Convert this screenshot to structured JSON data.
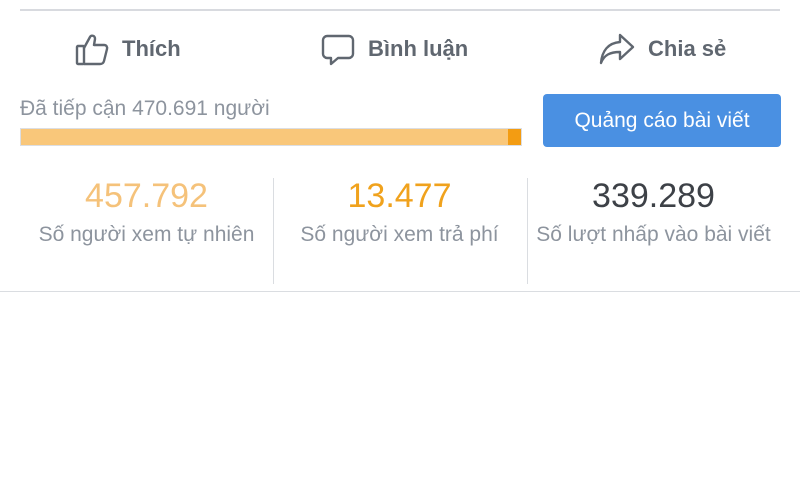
{
  "actions": {
    "like_label": "Thích",
    "comment_label": "Bình luận",
    "share_label": "Chia sẻ"
  },
  "reach": {
    "text": "Đã tiếp cận 470.691 người",
    "organic_fraction": 0.973,
    "paid_fraction": 0.027
  },
  "boost_button": {
    "label": "Quảng cáo bài viết"
  },
  "stats": [
    {
      "value": "457.792",
      "caption": "Số người xem tự nhiên"
    },
    {
      "value": "13.477",
      "caption": "Số người xem trả phí"
    },
    {
      "value": "339.289",
      "caption": "Số lượt nhấp vào bài viết"
    }
  ],
  "colors": {
    "organic": "#f9c77a",
    "paid": "#f39c12",
    "button_blue": "#4a90e2"
  },
  "icons": {
    "like": "thumbs-up-icon",
    "comment": "comment-bubble-icon",
    "share": "share-arrow-icon"
  }
}
